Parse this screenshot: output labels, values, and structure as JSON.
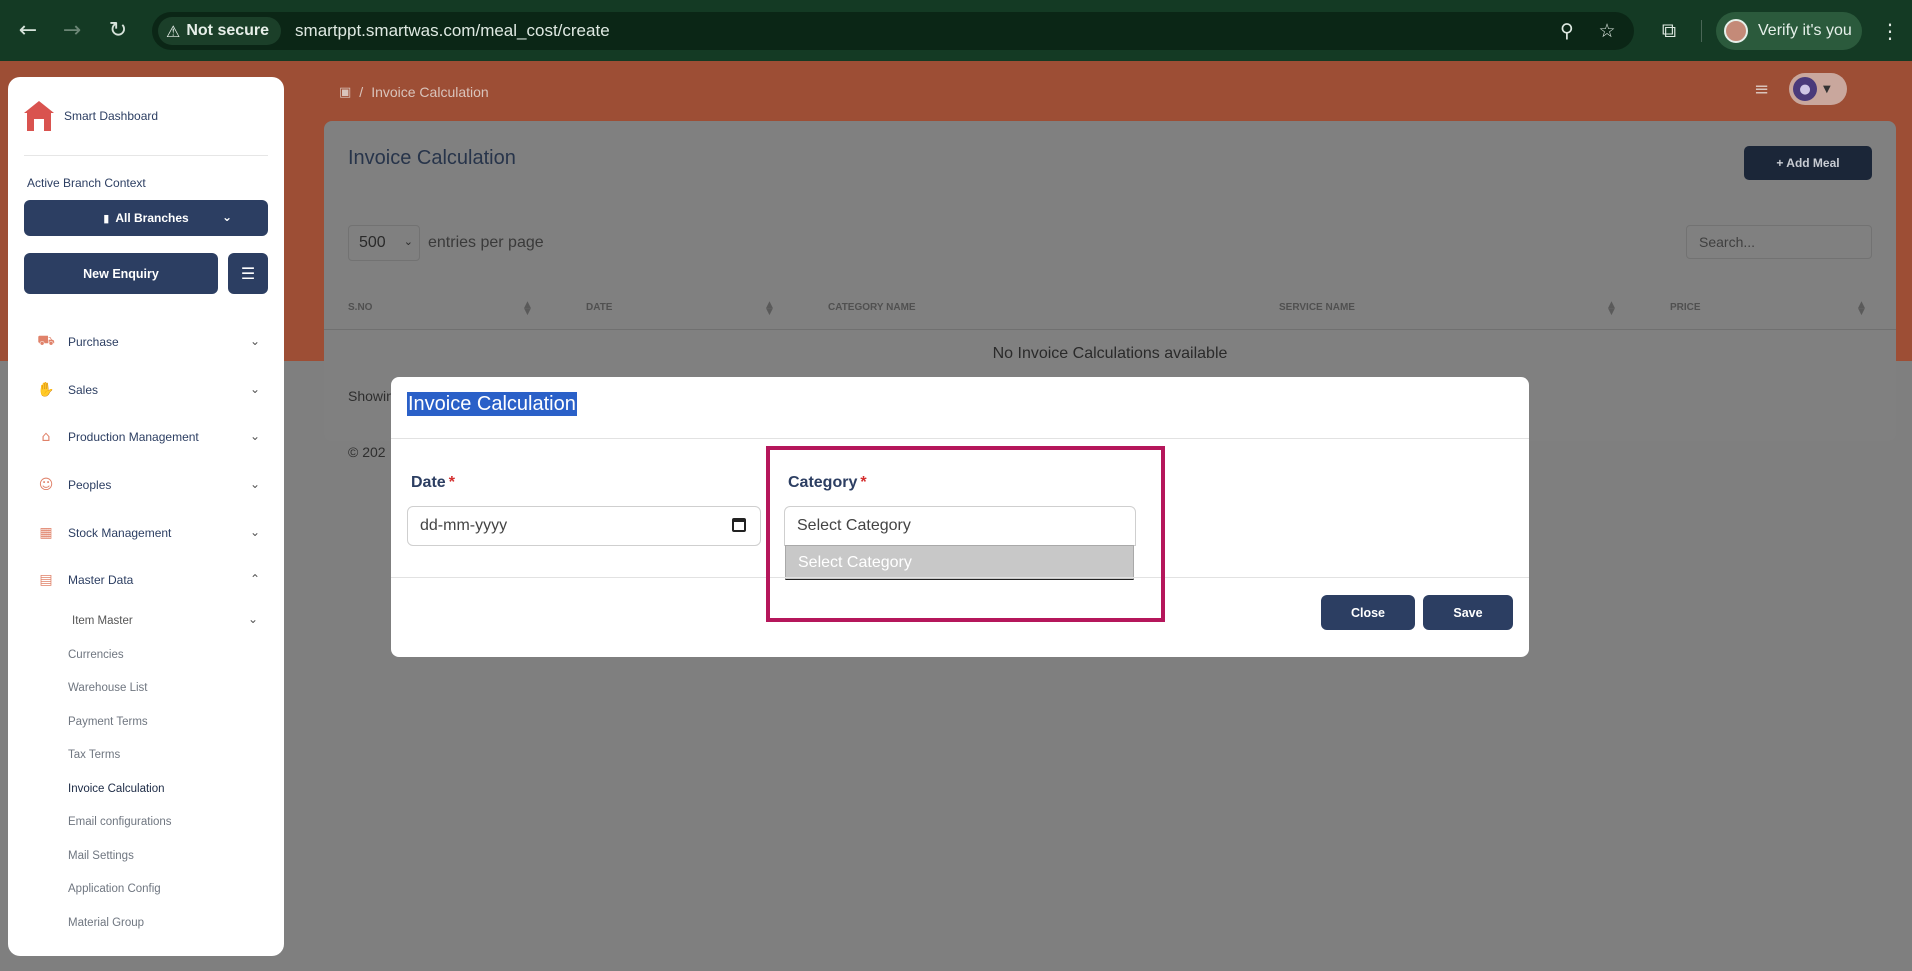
{
  "browser": {
    "security_label": "Not secure",
    "url": "smartppt.smartwas.com/meal_cost/create",
    "verify_label": "Verify it's you"
  },
  "sidebar": {
    "brand_name": "Smart Dashboard",
    "branch_context_title": "Active Branch Context",
    "branch_selected": "All Branches",
    "new_enquiry_label": "New Enquiry",
    "nav_items": [
      {
        "label": "Purchase",
        "icon": "cart-icon"
      },
      {
        "label": "Sales",
        "icon": "sales-icon"
      },
      {
        "label": "Production Management",
        "icon": "factory-icon"
      },
      {
        "label": "Peoples",
        "icon": "people-icon"
      },
      {
        "label": "Stock Management",
        "icon": "warehouse-icon"
      },
      {
        "label": "Master Data",
        "icon": "database-icon"
      }
    ],
    "item_master_label": "Item Master",
    "sub_items": [
      "Currencies",
      "Warehouse List",
      "Payment Terms",
      "Tax Terms",
      "Invoice Calculation",
      "Email configurations",
      "Mail Settings",
      "Application Config",
      "Material Group"
    ],
    "active_sub_item": "Invoice Calculation"
  },
  "topbar": {
    "breadcrumb_current": "Invoice Calculation"
  },
  "main": {
    "title": "Invoice Calculation",
    "add_button": "+ Add Meal",
    "entries_value": "500",
    "entries_label": "entries per page",
    "search_placeholder": "Search...",
    "columns": [
      "S.NO",
      "DATE",
      "CATEGORY NAME",
      "SERVICE NAME",
      "PRICE"
    ],
    "empty_message": "No Invoice Calculations available",
    "showing_text": "Showin",
    "footer_text": "© 202"
  },
  "modal": {
    "title": "Invoice Calculation",
    "date_label": "Date",
    "date_placeholder": "dd-mm-yyyy",
    "category_label": "Category",
    "required_mark": "*",
    "category_value": "Select Category",
    "dropdown_option": "Select Category",
    "close_label": "Close",
    "save_label": "Save"
  },
  "colors": {
    "accent_navy": "#2c3e62",
    "header_orange": "#9d4e35",
    "highlight_border": "#b5165b",
    "required_red": "#d42e2e"
  }
}
